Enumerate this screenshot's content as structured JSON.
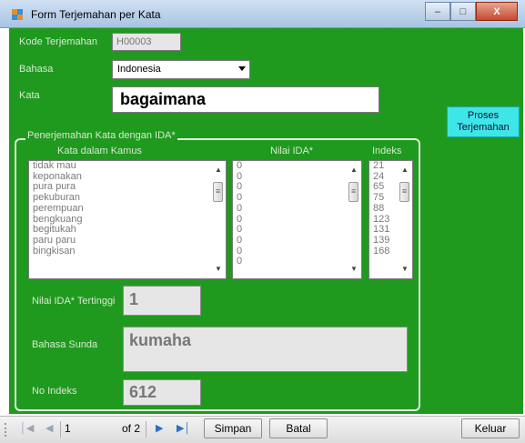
{
  "window": {
    "title": "Form Terjemahan per Kata",
    "minimize_glyph": "–",
    "maximize_glyph": "□",
    "close_glyph": "X"
  },
  "form": {
    "kode_label": "Kode Terjemahan",
    "kode_value": "H00003",
    "bahasa_label": "Bahasa",
    "bahasa_value": "Indonesia",
    "kata_label": "Kata",
    "kata_value": "bagaimana",
    "proses_label_line1": "Proses",
    "proses_label_line2": "Terjemahan"
  },
  "group": {
    "title": "Penerjemahan Kata dengan IDA*",
    "col_kata": "Kata dalam Kamus",
    "col_nilai": "Nilai IDA*",
    "col_indeks": "Indeks",
    "kata_list": [
      "tidak mau",
      "keponakan",
      "pura pura",
      "pekuburan",
      "perempuan",
      "bengkuang",
      "begitukah",
      "paru paru",
      "bingkisan"
    ],
    "nilai_list": [
      "0",
      "0",
      "0",
      "0",
      "0",
      "0",
      "0",
      "0",
      "0",
      "0"
    ],
    "indeks_list": [
      "21",
      "24",
      "65",
      "75",
      "88",
      "123",
      "131",
      "139",
      "168"
    ],
    "nilai_tertinggi_label": "Nilai IDA* Tertinggi",
    "nilai_tertinggi_value": "1",
    "bahasa_sunda_label": "Bahasa Sunda",
    "bahasa_sunda_value": "kumaha",
    "no_indeks_label": "No Indeks",
    "no_indeks_value": "612"
  },
  "navigator": {
    "position": "1",
    "of_total": "of 2",
    "simpan_label": "Simpan",
    "batal_label": "Batal",
    "keluar_label": "Keluar"
  }
}
